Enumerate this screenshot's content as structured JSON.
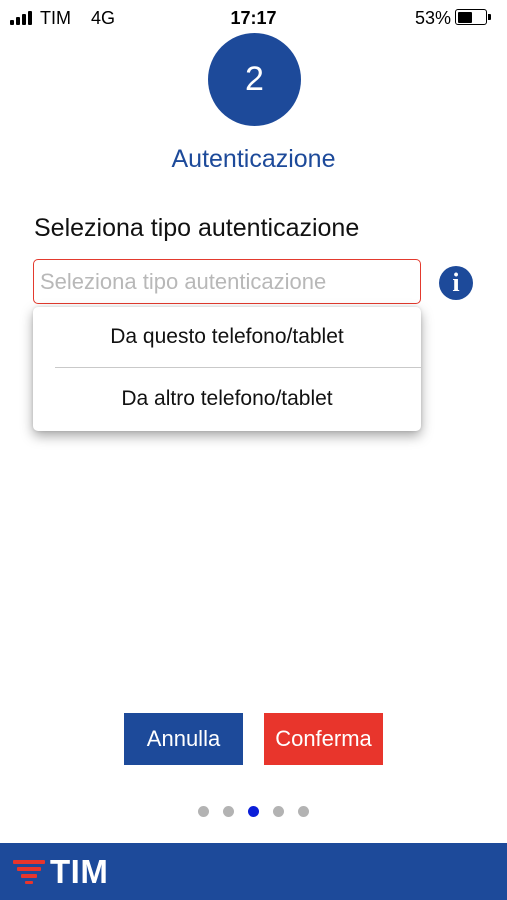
{
  "status_bar": {
    "carrier": "TIM",
    "network": "4G",
    "time": "17:17",
    "battery_percent_label": "53%",
    "battery_level": 0.53
  },
  "step": {
    "number": "2",
    "title": "Autenticazione"
  },
  "form": {
    "label": "Seleziona tipo autenticazione",
    "select": {
      "placeholder": "Seleziona tipo autenticazione",
      "value": ""
    },
    "info_icon": "info-icon"
  },
  "dropdown": {
    "options": [
      {
        "label": "Da questo telefono/tablet"
      },
      {
        "label": "Da altro telefono/tablet"
      }
    ]
  },
  "buttons": {
    "cancel_label": "Annulla",
    "confirm_label": "Conferma"
  },
  "pagination": {
    "total": 5,
    "active_index": 2
  },
  "footer": {
    "logo_text": "TIM"
  },
  "colors": {
    "brand_blue": "#1d4a9a",
    "brand_red": "#e8352c",
    "error_border": "#e33a2e",
    "active_dot": "#0b1ed8",
    "inactive_dot": "#b3b3b3"
  }
}
